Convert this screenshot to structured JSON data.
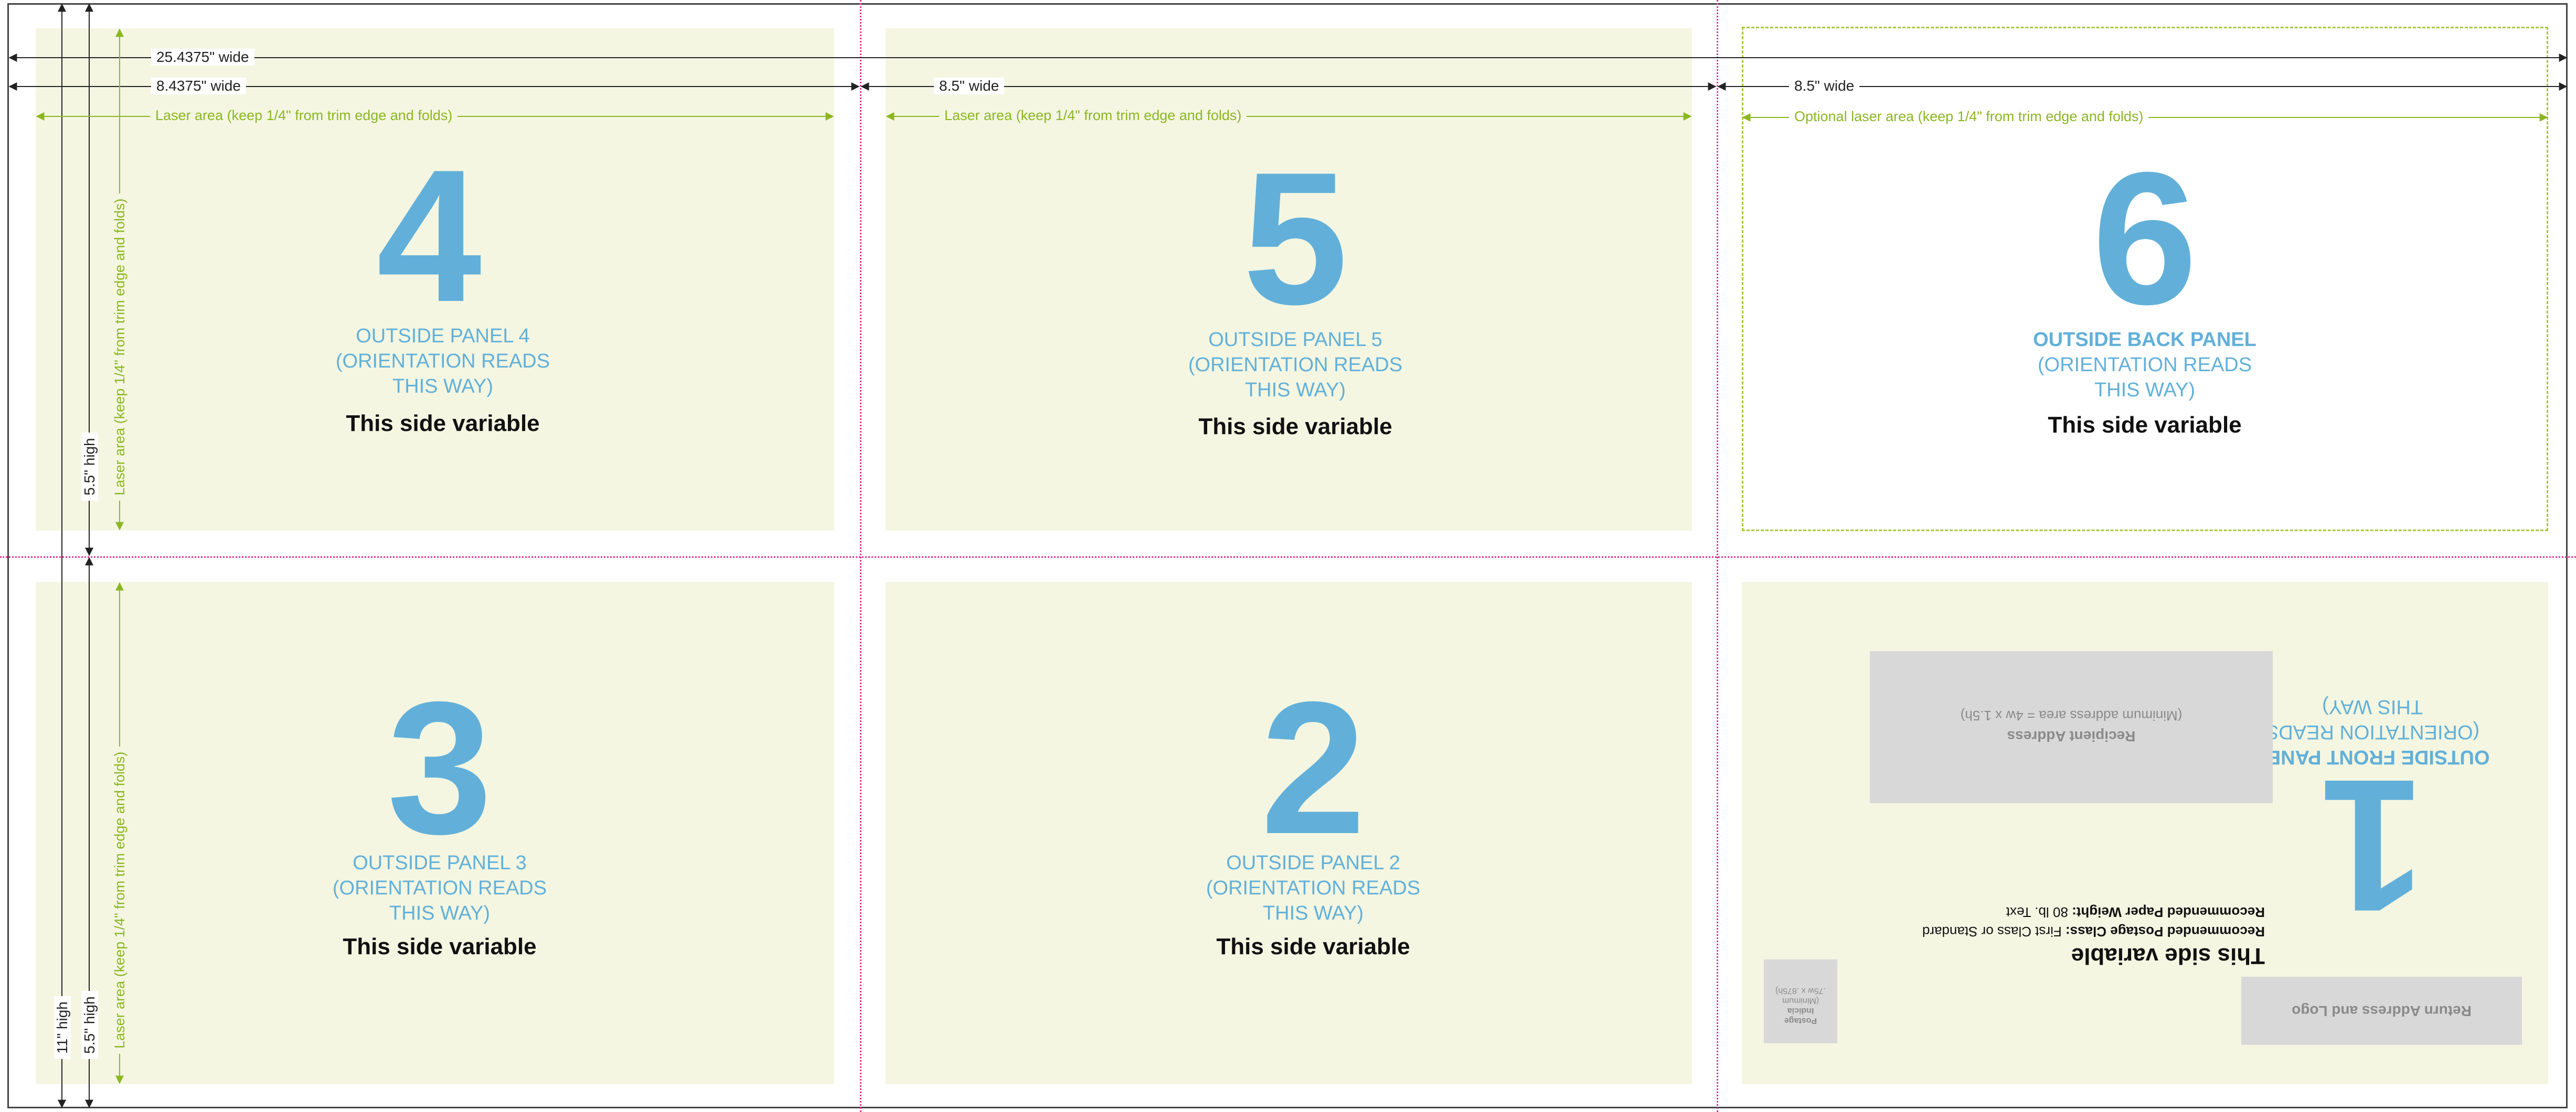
{
  "dimensions": {
    "total_width": "25.4375\" wide",
    "panel_a_width": "8.4375\" wide",
    "panel_b_width": "8.5\" wide",
    "panel_c_width": "8.5\" wide",
    "total_height": "11\" high",
    "half_height_top": "5.5\" high",
    "half_height_bottom": "5.5\" high"
  },
  "laser": {
    "horizontal": "Laser area (keep 1/4\" from trim edge and folds)",
    "optional": "Optional laser area (keep 1/4\" from trim edge and folds)",
    "vertical": "Laser area (keep 1/4\" from trim edge and folds)"
  },
  "panels": [
    {
      "number": "4",
      "line1": "OUTSIDE PANEL 4",
      "line2": "(ORIENTATION READS",
      "line3": "THIS WAY)",
      "variable": "This side variable"
    },
    {
      "number": "5",
      "line1": "OUTSIDE PANEL 5",
      "line2": "(ORIENTATION READS",
      "line3": "THIS WAY)",
      "variable": "This side variable"
    },
    {
      "number": "6",
      "line1": "OUTSIDE BACK PANEL",
      "line2": "(ORIENTATION READS",
      "line3": "THIS WAY)",
      "variable": "This side variable"
    },
    {
      "number": "3",
      "line1": "OUTSIDE PANEL 3",
      "line2": "(ORIENTATION READS",
      "line3": "THIS WAY)",
      "variable": "This side variable"
    },
    {
      "number": "2",
      "line1": "OUTSIDE PANEL 2",
      "line2": "(ORIENTATION READS",
      "line3": "THIS WAY)",
      "variable": "This side variable"
    }
  ],
  "front_panel": {
    "number": "1",
    "line1": "OUTSIDE FRONT PANEL",
    "line2": "(ORIENTATION READS",
    "line3": "THIS WAY)",
    "variable": "This side variable",
    "paper_class_label": "Recommended Postage Class:",
    "paper_class_value": "First Class or Standard",
    "paper_weight_label": "Recommended Paper Weight:",
    "paper_weight_value": "80 lb. Text",
    "recipient_title": "Recipient Address",
    "recipient_note": "(Minimum address area = 4w x 1.5h)",
    "return_address": "Return Address and Logo",
    "indicia_line1": "Postage",
    "indicia_line2": "Indicia",
    "indicia_line3": "(Minimum",
    "indicia_line4": ".75w x .875h)"
  },
  "colors": {
    "panel_fill": "#f4f6e2",
    "accent_blue": "#62b0d9",
    "laser_green": "#8cb623",
    "fold_magenta": "#e0338f",
    "grey_box": "#d8d8d8"
  }
}
